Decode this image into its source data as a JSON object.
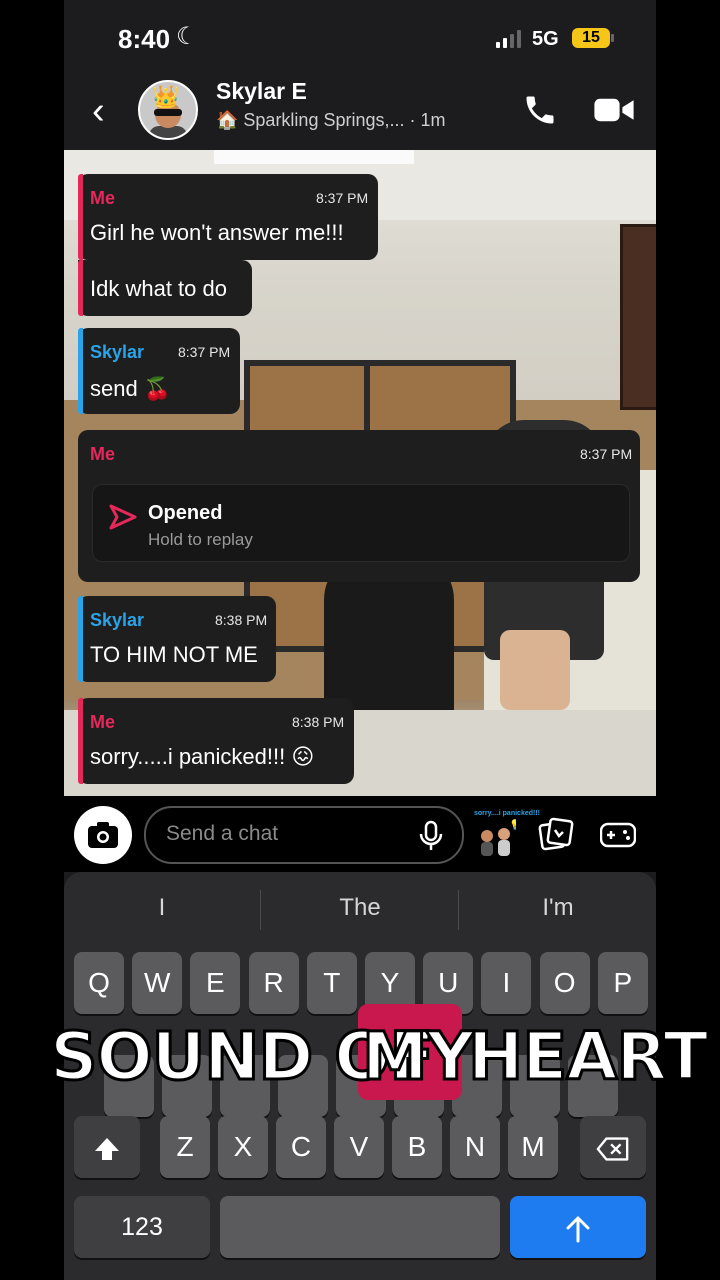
{
  "status": {
    "time": "8:40",
    "network": "5G",
    "battery": "15"
  },
  "header": {
    "contact_name": "Skylar E",
    "location": "🏠 Sparkling Springs,...",
    "last_seen": "· 1m"
  },
  "messages": [
    {
      "sender": "Me",
      "time": "8:37 PM",
      "lines": [
        "Girl he won't answer me!!!",
        "Idk what to do"
      ]
    },
    {
      "sender": "Skylar",
      "time": "8:37 PM",
      "text": "send 🍒"
    },
    {
      "sender": "Me",
      "time": "8:37 PM",
      "snap": {
        "title": "Opened",
        "subtitle": "Hold to replay"
      }
    },
    {
      "sender": "Skylar",
      "time": "8:38 PM",
      "text": "TO HIM NOT ME"
    },
    {
      "sender": "Me",
      "time": "8:38 PM",
      "text": "sorry.....i panicked!!! 😖"
    }
  ],
  "compose": {
    "placeholder": "Send a chat",
    "sticker_text": "sorry....i panicked!!!"
  },
  "keyboard": {
    "suggestions": [
      "I",
      "The",
      "I'm"
    ],
    "row1": [
      "Q",
      "W",
      "E",
      "R",
      "T",
      "Y",
      "U",
      "I",
      "O",
      "P"
    ],
    "row3": [
      "Z",
      "X",
      "C",
      "V",
      "B",
      "N",
      "M"
    ],
    "numbers_label": "123"
  },
  "caption": {
    "words": [
      "SOUND OF",
      "MY",
      "HEART"
    ]
  },
  "colors": {
    "me": "#e5285a",
    "skylar": "#2aa4e8",
    "send": "#1e7cf0",
    "highlight": "#c8184e"
  }
}
